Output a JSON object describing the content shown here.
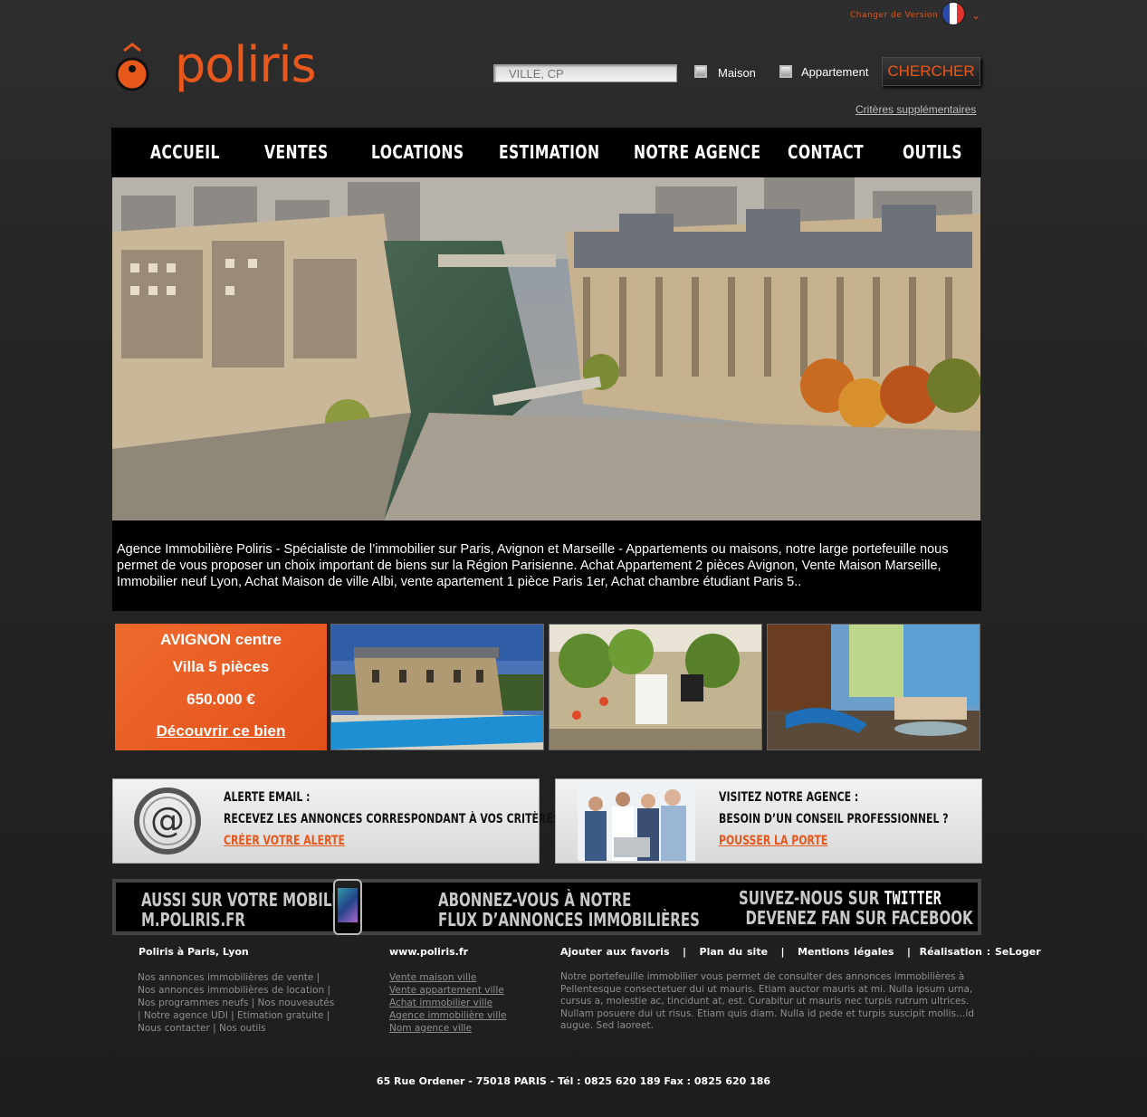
{
  "header": {
    "version_label": "Changer de Version",
    "flag_colors": [
      "#2b4aa8",
      "#ffffff",
      "#e0362f"
    ],
    "logo_text": "poliris",
    "brand_color": "#e8581d"
  },
  "search": {
    "placeholder": "VILLE, CP",
    "type_house": "Maison",
    "type_apartment": "Appartement",
    "button": "CHERCHER",
    "more_criteria": "Critères supplémentaires"
  },
  "nav": [
    "ACCUEIL",
    "VENTES",
    "LOCATIONS",
    "ESTIMATION",
    "NOTRE AGENCE",
    "CONTACT",
    "OUTILS"
  ],
  "intro": "Agence Immobilière Poliris - Spécialiste de l’immobilier sur Paris, Avignon et Marseille - Appartements ou maisons, notre large portefeuille nous permet de vous proposer un choix important de biens sur la Région Parisienne. Achat Appartement 2 pièces Avignon, Vente Maison Marseille, Immobilier neuf Lyon, Achat Maison de ville Albi, vente apartement 1 pièce Paris 1er, Achat chambre étudiant Paris 5..",
  "featured": {
    "city": "AVIGNON centre",
    "type": "Villa 5 pièces",
    "price": "650.000 €",
    "link": "Découvrir ce bien"
  },
  "promos": {
    "alert": {
      "title": "ALERTE EMAIL :",
      "text": "RECEVEZ LES ANNONCES CORRESPONDANT À VOS CRITÈRES",
      "link": "CRÉER VOTRE ALERTE"
    },
    "agency": {
      "title": "VISITEZ NOTRE AGENCE :",
      "text": "BESOIN D’UN CONSEIL PROFESSIONNEL ?",
      "link": "POUSSER LA PORTE"
    }
  },
  "banner": {
    "mobile_line1": "AUSSI SUR VOTRE  MOBILE",
    "mobile_line2": "M.POLIRIS.FR",
    "feed_line1": "ABONNEZ-VOUS À NOTRE",
    "feed_line2": "FLUX D’ANNONCES IMMOBILIÈRES",
    "social_line1": "SUIVEZ-NOUS SUR",
    "social_twitter": "TWITTER",
    "social_line2": "DEVENEZ FAN SUR FACEBOOK"
  },
  "footer": {
    "col1_title": "Poliris à Paris, Lyon",
    "col1_lines": [
      "Nos annonces immobilières de vente |",
      "Nos annonces immobilières de location |",
      "Nos programmes neufs | Nos nouveautés",
      "| Notre agence UDI | Etimation gratuite |",
      "Nous contacter | Nos outils"
    ],
    "col2_title": "www.poliris.fr",
    "col2_links": [
      "Vente maison ville",
      "Vente appartement ville",
      "Achat immobilier ville",
      "Agence immobilière ville",
      "Nom agence ville"
    ],
    "links": [
      "Ajouter aux favoris",
      "Plan du site",
      "Mentions légales",
      "Réalisation : SeLoger"
    ],
    "separator": "|",
    "description": "Notre portefeuille immobilier vous permet de consulter des annonces immobilières à Pellentesque consectetuer dui ut mauris. Etiam auctor mauris at mi. Nulla ipsum urna, cursus a, molestie ac, tincidunt at, est. Curabitur ut mauris nec turpis rutrum ultrices. Nullam posuere dui ut risus. Etiam quis diam. Nulla id pede et turpis suscipit mollis…id augue. Sed laoreet.",
    "address": "65 Rue Ordener - 75018 PARIS  -  Tél : 0825 620 189  Fax : 0825 620 186"
  }
}
